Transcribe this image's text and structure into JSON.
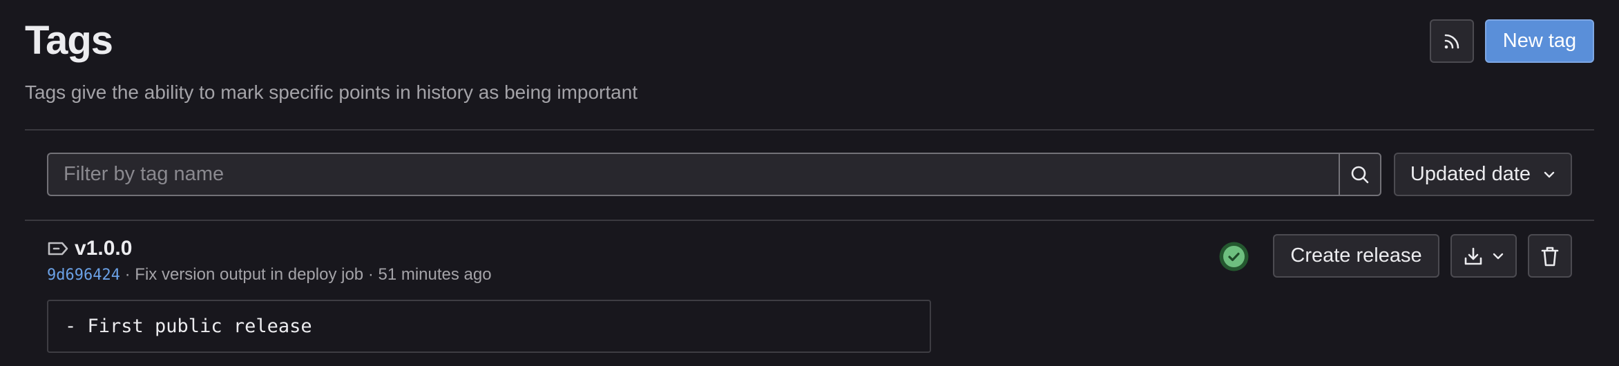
{
  "header": {
    "title": "Tags",
    "description": "Tags give the ability to mark specific points in history as being important",
    "rss_icon": "rss-icon",
    "new_tag_label": "New tag"
  },
  "filter": {
    "placeholder": "Filter by tag name",
    "value": "",
    "search_icon": "search-icon",
    "sort_label": "Updated date",
    "sort_icon": "chevron-down-icon"
  },
  "tags": [
    {
      "name": "v1.0.0",
      "icon": "tag-icon",
      "commit_sha": "9d696424",
      "separator": " · ",
      "commit_message": "Fix version output in deploy job",
      "time_ago": "51 minutes ago",
      "release_notes": "- First public release",
      "pipeline_status": "passed",
      "actions": {
        "create_release_label": "Create release",
        "download_icon": "download-icon",
        "delete_icon": "trash-icon"
      }
    }
  ],
  "colors": {
    "background": "#18171d",
    "accent": "#5a8fd9",
    "link": "#6ba1e6",
    "success": "#6ebf7f",
    "success_ring": "#24582f"
  }
}
